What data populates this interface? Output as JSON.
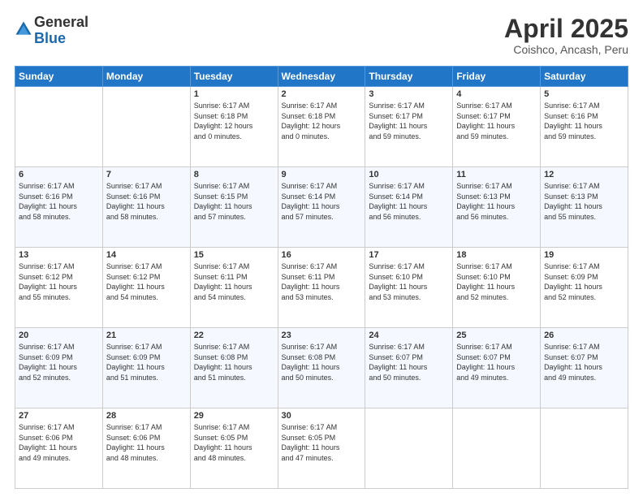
{
  "header": {
    "logo_general": "General",
    "logo_blue": "Blue",
    "title": "April 2025",
    "location": "Coishco, Ancash, Peru"
  },
  "days_of_week": [
    "Sunday",
    "Monday",
    "Tuesday",
    "Wednesday",
    "Thursday",
    "Friday",
    "Saturday"
  ],
  "weeks": [
    [
      {
        "day": "",
        "info": ""
      },
      {
        "day": "",
        "info": ""
      },
      {
        "day": "1",
        "info": "Sunrise: 6:17 AM\nSunset: 6:18 PM\nDaylight: 12 hours\nand 0 minutes."
      },
      {
        "day": "2",
        "info": "Sunrise: 6:17 AM\nSunset: 6:18 PM\nDaylight: 12 hours\nand 0 minutes."
      },
      {
        "day": "3",
        "info": "Sunrise: 6:17 AM\nSunset: 6:17 PM\nDaylight: 11 hours\nand 59 minutes."
      },
      {
        "day": "4",
        "info": "Sunrise: 6:17 AM\nSunset: 6:17 PM\nDaylight: 11 hours\nand 59 minutes."
      },
      {
        "day": "5",
        "info": "Sunrise: 6:17 AM\nSunset: 6:16 PM\nDaylight: 11 hours\nand 59 minutes."
      }
    ],
    [
      {
        "day": "6",
        "info": "Sunrise: 6:17 AM\nSunset: 6:16 PM\nDaylight: 11 hours\nand 58 minutes."
      },
      {
        "day": "7",
        "info": "Sunrise: 6:17 AM\nSunset: 6:16 PM\nDaylight: 11 hours\nand 58 minutes."
      },
      {
        "day": "8",
        "info": "Sunrise: 6:17 AM\nSunset: 6:15 PM\nDaylight: 11 hours\nand 57 minutes."
      },
      {
        "day": "9",
        "info": "Sunrise: 6:17 AM\nSunset: 6:14 PM\nDaylight: 11 hours\nand 57 minutes."
      },
      {
        "day": "10",
        "info": "Sunrise: 6:17 AM\nSunset: 6:14 PM\nDaylight: 11 hours\nand 56 minutes."
      },
      {
        "day": "11",
        "info": "Sunrise: 6:17 AM\nSunset: 6:13 PM\nDaylight: 11 hours\nand 56 minutes."
      },
      {
        "day": "12",
        "info": "Sunrise: 6:17 AM\nSunset: 6:13 PM\nDaylight: 11 hours\nand 55 minutes."
      }
    ],
    [
      {
        "day": "13",
        "info": "Sunrise: 6:17 AM\nSunset: 6:12 PM\nDaylight: 11 hours\nand 55 minutes."
      },
      {
        "day": "14",
        "info": "Sunrise: 6:17 AM\nSunset: 6:12 PM\nDaylight: 11 hours\nand 54 minutes."
      },
      {
        "day": "15",
        "info": "Sunrise: 6:17 AM\nSunset: 6:11 PM\nDaylight: 11 hours\nand 54 minutes."
      },
      {
        "day": "16",
        "info": "Sunrise: 6:17 AM\nSunset: 6:11 PM\nDaylight: 11 hours\nand 53 minutes."
      },
      {
        "day": "17",
        "info": "Sunrise: 6:17 AM\nSunset: 6:10 PM\nDaylight: 11 hours\nand 53 minutes."
      },
      {
        "day": "18",
        "info": "Sunrise: 6:17 AM\nSunset: 6:10 PM\nDaylight: 11 hours\nand 52 minutes."
      },
      {
        "day": "19",
        "info": "Sunrise: 6:17 AM\nSunset: 6:09 PM\nDaylight: 11 hours\nand 52 minutes."
      }
    ],
    [
      {
        "day": "20",
        "info": "Sunrise: 6:17 AM\nSunset: 6:09 PM\nDaylight: 11 hours\nand 52 minutes."
      },
      {
        "day": "21",
        "info": "Sunrise: 6:17 AM\nSunset: 6:09 PM\nDaylight: 11 hours\nand 51 minutes."
      },
      {
        "day": "22",
        "info": "Sunrise: 6:17 AM\nSunset: 6:08 PM\nDaylight: 11 hours\nand 51 minutes."
      },
      {
        "day": "23",
        "info": "Sunrise: 6:17 AM\nSunset: 6:08 PM\nDaylight: 11 hours\nand 50 minutes."
      },
      {
        "day": "24",
        "info": "Sunrise: 6:17 AM\nSunset: 6:07 PM\nDaylight: 11 hours\nand 50 minutes."
      },
      {
        "day": "25",
        "info": "Sunrise: 6:17 AM\nSunset: 6:07 PM\nDaylight: 11 hours\nand 49 minutes."
      },
      {
        "day": "26",
        "info": "Sunrise: 6:17 AM\nSunset: 6:07 PM\nDaylight: 11 hours\nand 49 minutes."
      }
    ],
    [
      {
        "day": "27",
        "info": "Sunrise: 6:17 AM\nSunset: 6:06 PM\nDaylight: 11 hours\nand 49 minutes."
      },
      {
        "day": "28",
        "info": "Sunrise: 6:17 AM\nSunset: 6:06 PM\nDaylight: 11 hours\nand 48 minutes."
      },
      {
        "day": "29",
        "info": "Sunrise: 6:17 AM\nSunset: 6:05 PM\nDaylight: 11 hours\nand 48 minutes."
      },
      {
        "day": "30",
        "info": "Sunrise: 6:17 AM\nSunset: 6:05 PM\nDaylight: 11 hours\nand 47 minutes."
      },
      {
        "day": "",
        "info": ""
      },
      {
        "day": "",
        "info": ""
      },
      {
        "day": "",
        "info": ""
      }
    ]
  ]
}
